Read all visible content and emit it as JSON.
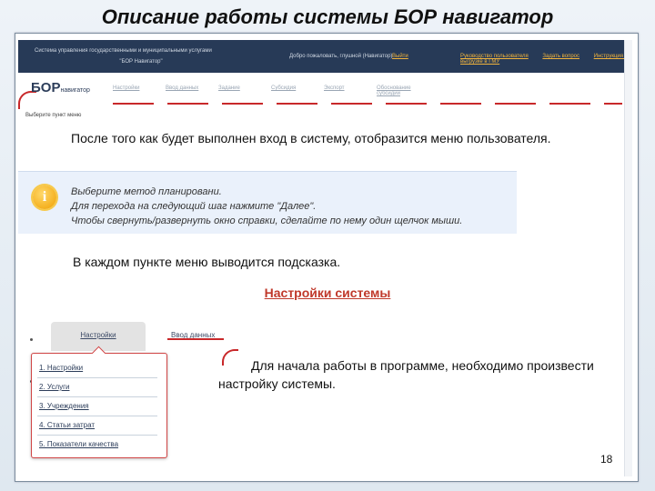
{
  "slide": {
    "title": "Описание работы системы БОР навигатор",
    "page_number": "18"
  },
  "app": {
    "system_name_line1": "Система управления государственными и муниципальными услугами",
    "system_name_line2": "\"БОР Навигатор\"",
    "welcome": "Добро пожаловать, глушной (Навигатор)",
    "exit": "Выйти",
    "top_links": [
      "Руководство пользователя",
      "Задать вопрос",
      "Инструкция по выгрузке в ГМУ"
    ],
    "logo_main": "БОР",
    "logo_sub": "навигатор",
    "menu": [
      "Настройки",
      "Ввод данных",
      "Задание",
      "Субсидия",
      "Экспорт",
      "Обоснование субсидий"
    ],
    "hint": "Выберите пункт меню"
  },
  "text": {
    "para1": "После того как будет выполнен вход в систему, отобразится меню пользователя.",
    "para2": "В каждом пункте меню выводится подсказка.",
    "subheading": "Настройки системы",
    "para3": "Для начала работы в программе, необходимо произвести настройку системы."
  },
  "info_box": {
    "icon": "info-icon",
    "lines": [
      "Выберите метод планировани.",
      "Для перехода на следующий шаг нажмите \"Далее\".",
      "Чтобы свернуть/развернуть окно справки, сделайте по нему один щелчок мыши."
    ]
  },
  "settings_menu": {
    "active_tab": "Настройки",
    "other_tab": "Ввод данных",
    "items": [
      "1. Настройки",
      "2. Услуги",
      "3. Учреждения",
      "4. Статьи затрат",
      "5. Показатели качества"
    ]
  },
  "colors": {
    "topbar": "#273a57",
    "accent": "#c8282a",
    "link": "#f2b43c",
    "subheading": "#c0392b"
  }
}
